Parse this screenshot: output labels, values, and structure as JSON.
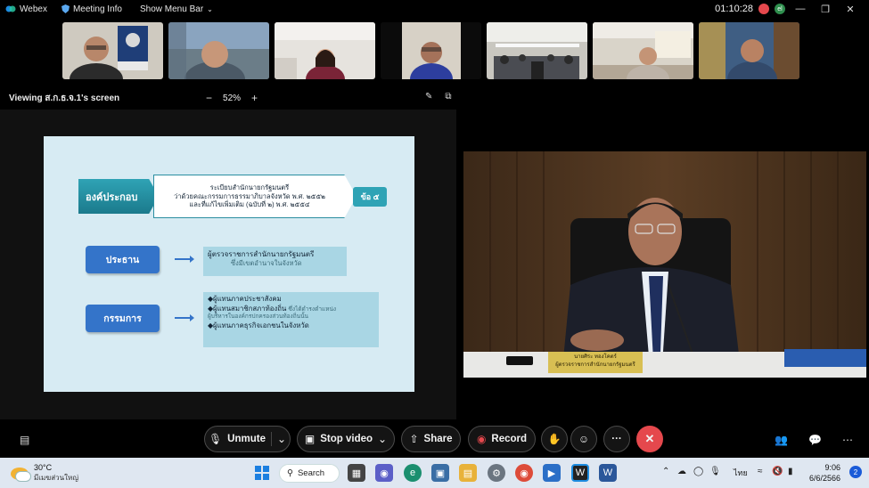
{
  "topbar": {
    "app_name": "Webex",
    "meeting_info": "Meeting Info",
    "show_menu_bar": "Show Menu Bar",
    "timer": "01:10:28",
    "recording_indicator": "●",
    "avatar_initial": "el"
  },
  "viewbar": {
    "viewing_label": "Viewing ส.ก.ธ.จ.1's screen",
    "zoom_level": "52%"
  },
  "slide": {
    "org_label": "องค์ประกอบ",
    "regulation_line1": "ระเบียบสำนักนายกรัฐมนตรี",
    "regulation_line2": "ว่าด้วยคณะกรรมการธรรมาภิบาลจังหวัด พ.ศ. ๒๕๕๒",
    "regulation_line3": "และที่แก้ไขเพิ่มเติม (ฉบับที่ ๒) พ.ศ. ๒๕๕๔",
    "clause": "ข้อ ๕",
    "chair_label": "ประธาน",
    "chair_desc1": "ผู้ตรวจราชการสำนักนายกรัฐมนตรี",
    "chair_desc2": "ซึ่งมีเขตอำนาจในจังหวัด",
    "committee_label": "กรรมการ",
    "committee_item1": "◆ผู้แทนภาคประชาสังคม",
    "committee_item2": "◆ผู้แทนสมาชิกสภาท้องถิ่น",
    "committee_item2_note": "ซึ่งได้ดำรงตำแหน่ง",
    "committee_item2_note2": "ผู้บริหารในองค์กรปกครองส่วนท้องถิ่นนั้น",
    "committee_item3": "◆ผู้แทนภาคธุรกิจเอกชนในจังหวัด"
  },
  "nameplate": {
    "name": "นายศิระ  ทองโคตร์",
    "title": "ผู้ตรวจราชการสำนักนายกรัฐมนตรี"
  },
  "controls": {
    "unmute": "Unmute",
    "stop_video": "Stop video",
    "share": "Share",
    "record": "Record",
    "more": "···",
    "end": "✕"
  },
  "taskbar": {
    "temperature": "30°C",
    "weather_desc": "มีเมฆส่วนใหญ่",
    "search": "Search",
    "language": "ไทย",
    "time": "9:06",
    "date": "6/6/2566",
    "notifications": "2"
  },
  "colors": {
    "end_button": "#e5484d",
    "slide_bg": "#d7ebf3",
    "pill_blue": "#3474c9",
    "teal": "#2fa3b5",
    "taskbar_bg": "#dfe7f1"
  }
}
